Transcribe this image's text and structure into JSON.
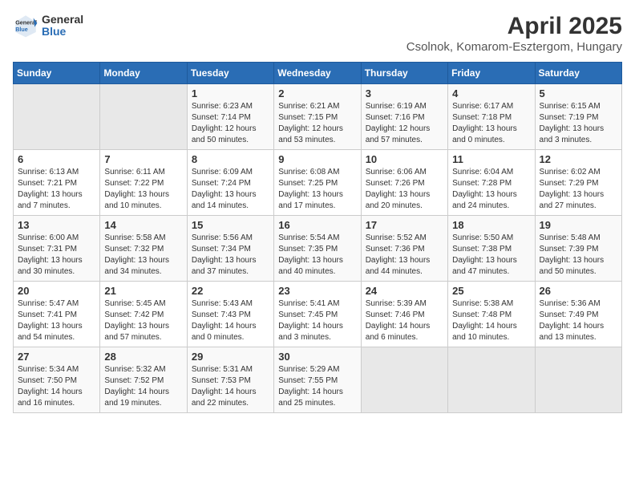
{
  "header": {
    "logo_general": "General",
    "logo_blue": "Blue",
    "title": "April 2025",
    "subtitle": "Csolnok, Komarom-Esztergom, Hungary"
  },
  "weekdays": [
    "Sunday",
    "Monday",
    "Tuesday",
    "Wednesday",
    "Thursday",
    "Friday",
    "Saturday"
  ],
  "weeks": [
    [
      {
        "day": "",
        "sunrise": "",
        "sunset": "",
        "daylight": ""
      },
      {
        "day": "",
        "sunrise": "",
        "sunset": "",
        "daylight": ""
      },
      {
        "day": "1",
        "sunrise": "Sunrise: 6:23 AM",
        "sunset": "Sunset: 7:14 PM",
        "daylight": "Daylight: 12 hours and 50 minutes."
      },
      {
        "day": "2",
        "sunrise": "Sunrise: 6:21 AM",
        "sunset": "Sunset: 7:15 PM",
        "daylight": "Daylight: 12 hours and 53 minutes."
      },
      {
        "day": "3",
        "sunrise": "Sunrise: 6:19 AM",
        "sunset": "Sunset: 7:16 PM",
        "daylight": "Daylight: 12 hours and 57 minutes."
      },
      {
        "day": "4",
        "sunrise": "Sunrise: 6:17 AM",
        "sunset": "Sunset: 7:18 PM",
        "daylight": "Daylight: 13 hours and 0 minutes."
      },
      {
        "day": "5",
        "sunrise": "Sunrise: 6:15 AM",
        "sunset": "Sunset: 7:19 PM",
        "daylight": "Daylight: 13 hours and 3 minutes."
      }
    ],
    [
      {
        "day": "6",
        "sunrise": "Sunrise: 6:13 AM",
        "sunset": "Sunset: 7:21 PM",
        "daylight": "Daylight: 13 hours and 7 minutes."
      },
      {
        "day": "7",
        "sunrise": "Sunrise: 6:11 AM",
        "sunset": "Sunset: 7:22 PM",
        "daylight": "Daylight: 13 hours and 10 minutes."
      },
      {
        "day": "8",
        "sunrise": "Sunrise: 6:09 AM",
        "sunset": "Sunset: 7:24 PM",
        "daylight": "Daylight: 13 hours and 14 minutes."
      },
      {
        "day": "9",
        "sunrise": "Sunrise: 6:08 AM",
        "sunset": "Sunset: 7:25 PM",
        "daylight": "Daylight: 13 hours and 17 minutes."
      },
      {
        "day": "10",
        "sunrise": "Sunrise: 6:06 AM",
        "sunset": "Sunset: 7:26 PM",
        "daylight": "Daylight: 13 hours and 20 minutes."
      },
      {
        "day": "11",
        "sunrise": "Sunrise: 6:04 AM",
        "sunset": "Sunset: 7:28 PM",
        "daylight": "Daylight: 13 hours and 24 minutes."
      },
      {
        "day": "12",
        "sunrise": "Sunrise: 6:02 AM",
        "sunset": "Sunset: 7:29 PM",
        "daylight": "Daylight: 13 hours and 27 minutes."
      }
    ],
    [
      {
        "day": "13",
        "sunrise": "Sunrise: 6:00 AM",
        "sunset": "Sunset: 7:31 PM",
        "daylight": "Daylight: 13 hours and 30 minutes."
      },
      {
        "day": "14",
        "sunrise": "Sunrise: 5:58 AM",
        "sunset": "Sunset: 7:32 PM",
        "daylight": "Daylight: 13 hours and 34 minutes."
      },
      {
        "day": "15",
        "sunrise": "Sunrise: 5:56 AM",
        "sunset": "Sunset: 7:34 PM",
        "daylight": "Daylight: 13 hours and 37 minutes."
      },
      {
        "day": "16",
        "sunrise": "Sunrise: 5:54 AM",
        "sunset": "Sunset: 7:35 PM",
        "daylight": "Daylight: 13 hours and 40 minutes."
      },
      {
        "day": "17",
        "sunrise": "Sunrise: 5:52 AM",
        "sunset": "Sunset: 7:36 PM",
        "daylight": "Daylight: 13 hours and 44 minutes."
      },
      {
        "day": "18",
        "sunrise": "Sunrise: 5:50 AM",
        "sunset": "Sunset: 7:38 PM",
        "daylight": "Daylight: 13 hours and 47 minutes."
      },
      {
        "day": "19",
        "sunrise": "Sunrise: 5:48 AM",
        "sunset": "Sunset: 7:39 PM",
        "daylight": "Daylight: 13 hours and 50 minutes."
      }
    ],
    [
      {
        "day": "20",
        "sunrise": "Sunrise: 5:47 AM",
        "sunset": "Sunset: 7:41 PM",
        "daylight": "Daylight: 13 hours and 54 minutes."
      },
      {
        "day": "21",
        "sunrise": "Sunrise: 5:45 AM",
        "sunset": "Sunset: 7:42 PM",
        "daylight": "Daylight: 13 hours and 57 minutes."
      },
      {
        "day": "22",
        "sunrise": "Sunrise: 5:43 AM",
        "sunset": "Sunset: 7:43 PM",
        "daylight": "Daylight: 14 hours and 0 minutes."
      },
      {
        "day": "23",
        "sunrise": "Sunrise: 5:41 AM",
        "sunset": "Sunset: 7:45 PM",
        "daylight": "Daylight: 14 hours and 3 minutes."
      },
      {
        "day": "24",
        "sunrise": "Sunrise: 5:39 AM",
        "sunset": "Sunset: 7:46 PM",
        "daylight": "Daylight: 14 hours and 6 minutes."
      },
      {
        "day": "25",
        "sunrise": "Sunrise: 5:38 AM",
        "sunset": "Sunset: 7:48 PM",
        "daylight": "Daylight: 14 hours and 10 minutes."
      },
      {
        "day": "26",
        "sunrise": "Sunrise: 5:36 AM",
        "sunset": "Sunset: 7:49 PM",
        "daylight": "Daylight: 14 hours and 13 minutes."
      }
    ],
    [
      {
        "day": "27",
        "sunrise": "Sunrise: 5:34 AM",
        "sunset": "Sunset: 7:50 PM",
        "daylight": "Daylight: 14 hours and 16 minutes."
      },
      {
        "day": "28",
        "sunrise": "Sunrise: 5:32 AM",
        "sunset": "Sunset: 7:52 PM",
        "daylight": "Daylight: 14 hours and 19 minutes."
      },
      {
        "day": "29",
        "sunrise": "Sunrise: 5:31 AM",
        "sunset": "Sunset: 7:53 PM",
        "daylight": "Daylight: 14 hours and 22 minutes."
      },
      {
        "day": "30",
        "sunrise": "Sunrise: 5:29 AM",
        "sunset": "Sunset: 7:55 PM",
        "daylight": "Daylight: 14 hours and 25 minutes."
      },
      {
        "day": "",
        "sunrise": "",
        "sunset": "",
        "daylight": ""
      },
      {
        "day": "",
        "sunrise": "",
        "sunset": "",
        "daylight": ""
      },
      {
        "day": "",
        "sunrise": "",
        "sunset": "",
        "daylight": ""
      }
    ]
  ]
}
